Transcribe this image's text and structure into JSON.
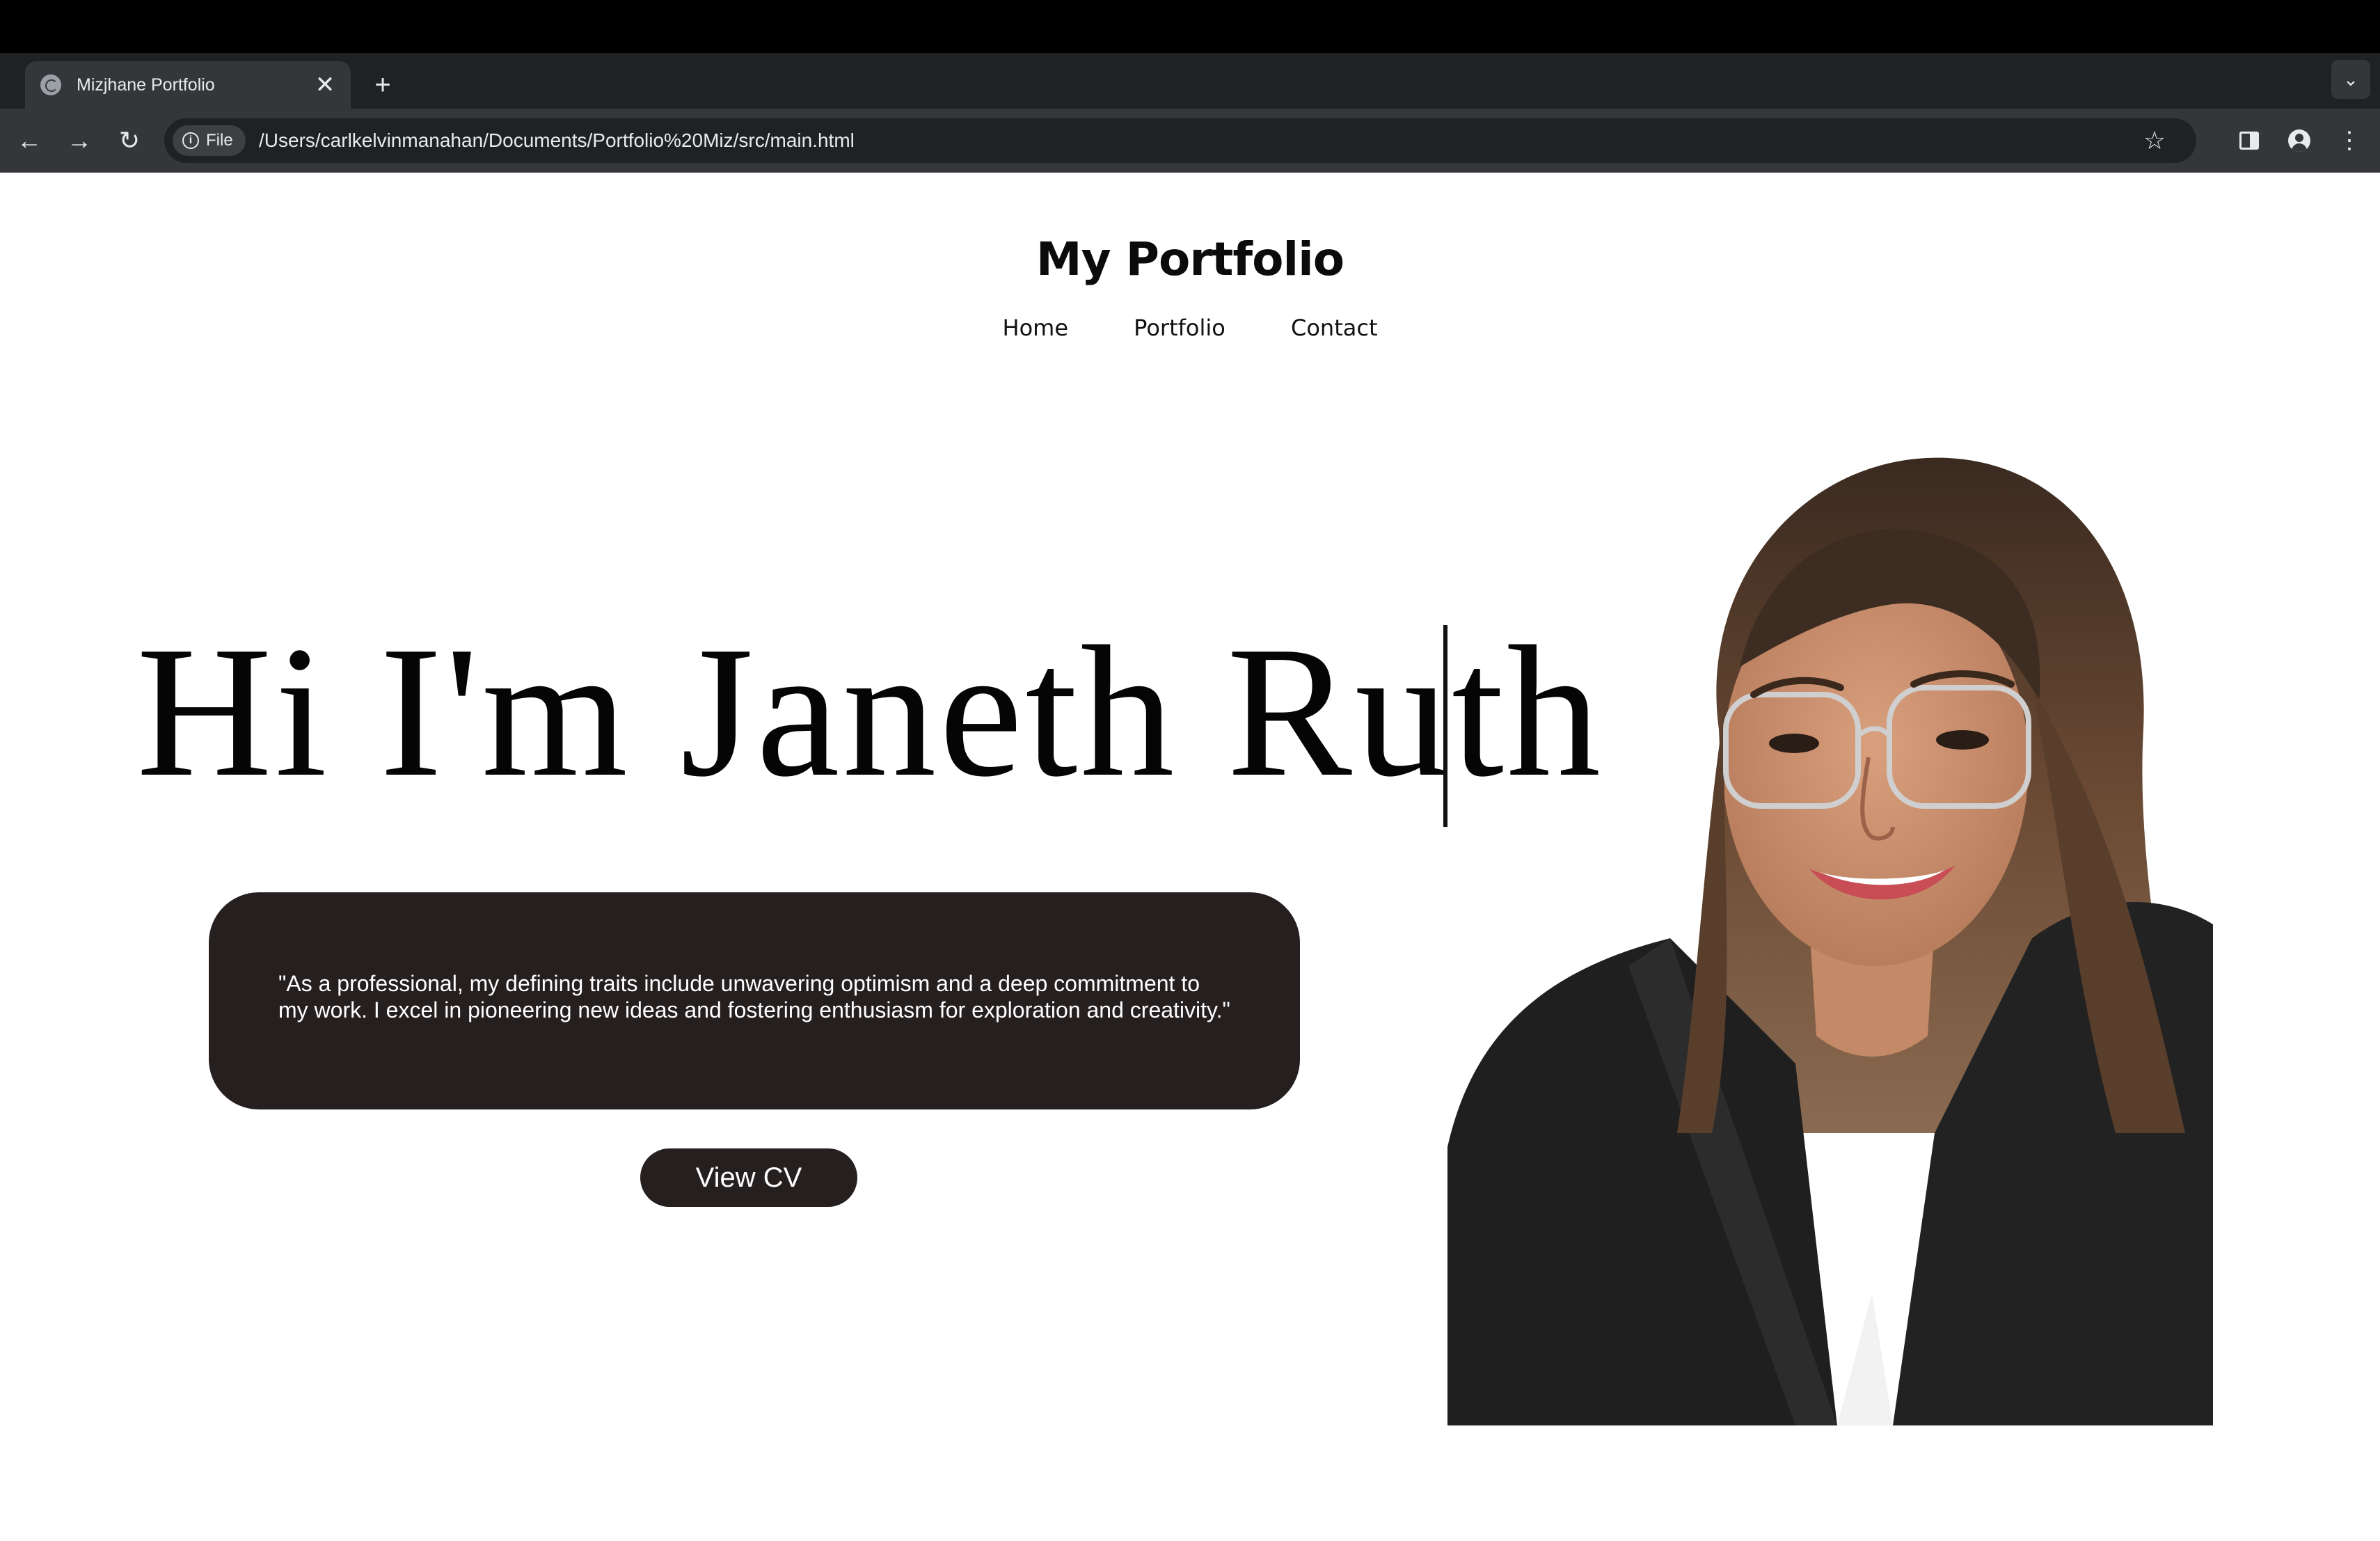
{
  "browser": {
    "tab": {
      "title": "Mizjhane Portfolio",
      "close_glyph": "✕"
    },
    "new_tab_glyph": "+",
    "tab_list_glyph": "⌄",
    "nav": {
      "back_glyph": "←",
      "forward_glyph": "→",
      "reload_glyph": "↻"
    },
    "address": {
      "scheme_chip": "File",
      "url": "/Users/carlkelvinmanahan/Documents/Portfolio%20Miz/src/main.html"
    },
    "bookmark_glyph": "☆",
    "menu_glyph": "⋮",
    "colors": {
      "frame": "#202124",
      "toolbar": "#35363a",
      "text": "#e8eaed"
    }
  },
  "site": {
    "title": "My Portfolio",
    "nav": [
      {
        "label": "Home"
      },
      {
        "label": "Portfolio"
      },
      {
        "label": "Contact"
      }
    ],
    "hero_heading": "Hi I'm Janeth Ruth",
    "quote": "\"As a professional, my defining traits include unwavering optimism and a deep commitment to my work. I excel in pioneering new ideas and fostering enthusiasm for exploration and creativity.\"",
    "cta_label": "View CV",
    "colors": {
      "accent": "#261f1f",
      "background": "#ffffff"
    }
  }
}
